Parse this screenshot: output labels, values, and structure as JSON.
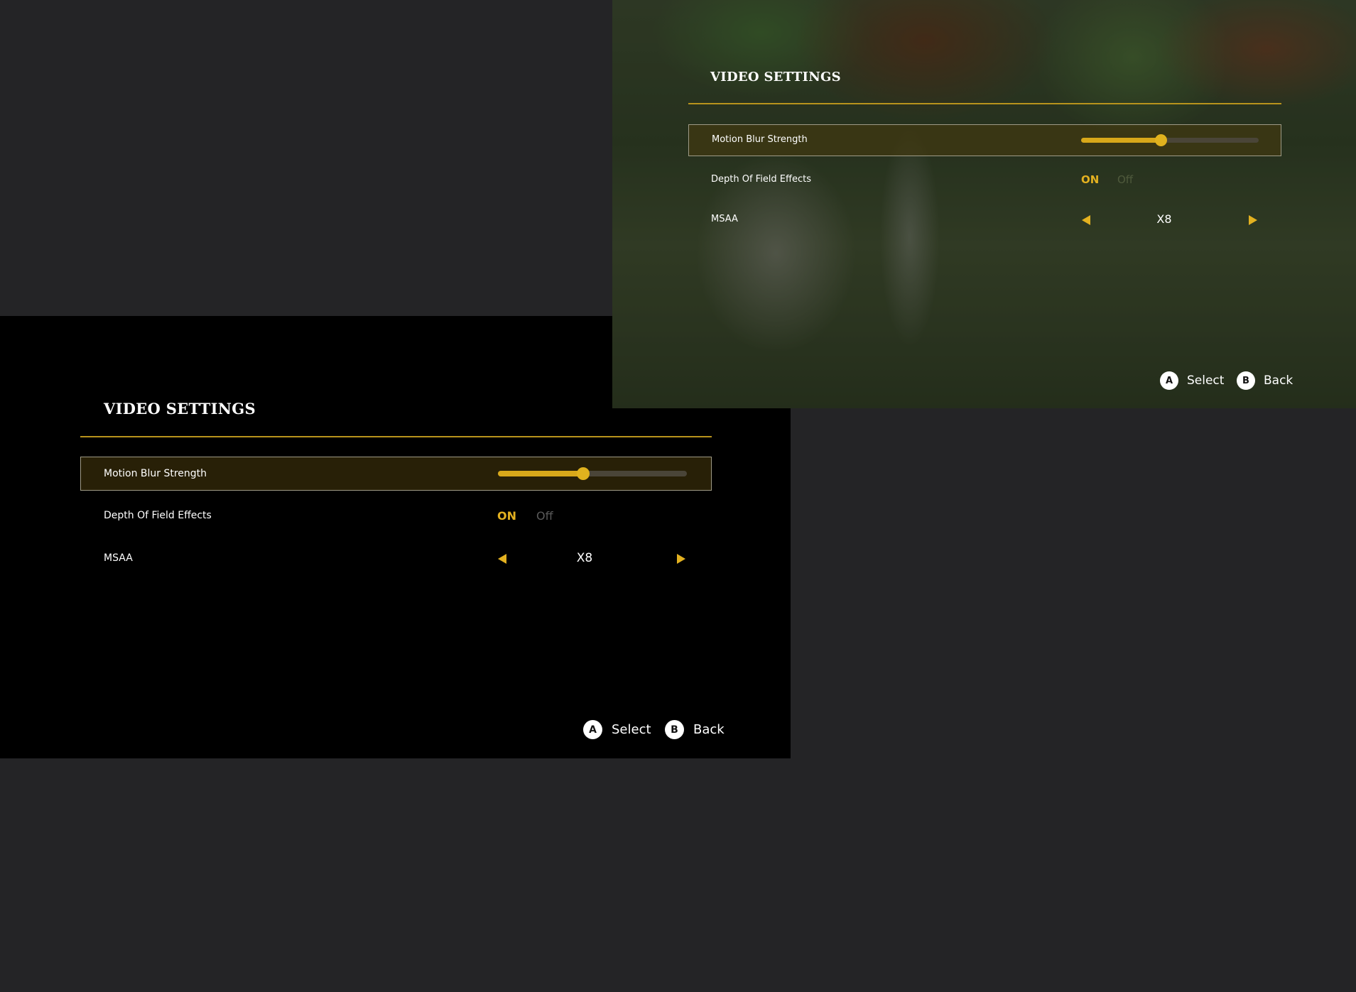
{
  "colors": {
    "accent": "#e3b120",
    "rule": "#b8931c",
    "background": "#242426"
  },
  "dark_panel": {
    "title": "VIDEO SETTINGS",
    "rows": [
      {
        "label": "Motion Blur Strength",
        "slider_fraction": 0.45
      },
      {
        "label": "Depth Of Field Effects",
        "on_label": "ON",
        "off_label": "Off",
        "selected": "ON"
      },
      {
        "label": "MSAA",
        "value": "X8"
      }
    ],
    "hints": [
      {
        "button": "A",
        "label": "Select"
      },
      {
        "button": "B",
        "label": "Back"
      }
    ]
  },
  "scene_panel": {
    "title": "VIDEO SETTINGS",
    "rows": [
      {
        "label": "Motion Blur Strength",
        "slider_fraction": 0.45
      },
      {
        "label": "Depth Of Field Effects",
        "on_label": "ON",
        "off_label": "Off",
        "selected": "ON"
      },
      {
        "label": "MSAA",
        "value": "X8"
      }
    ],
    "hints": [
      {
        "button": "A",
        "label": "Select"
      },
      {
        "button": "B",
        "label": "Back"
      }
    ]
  }
}
